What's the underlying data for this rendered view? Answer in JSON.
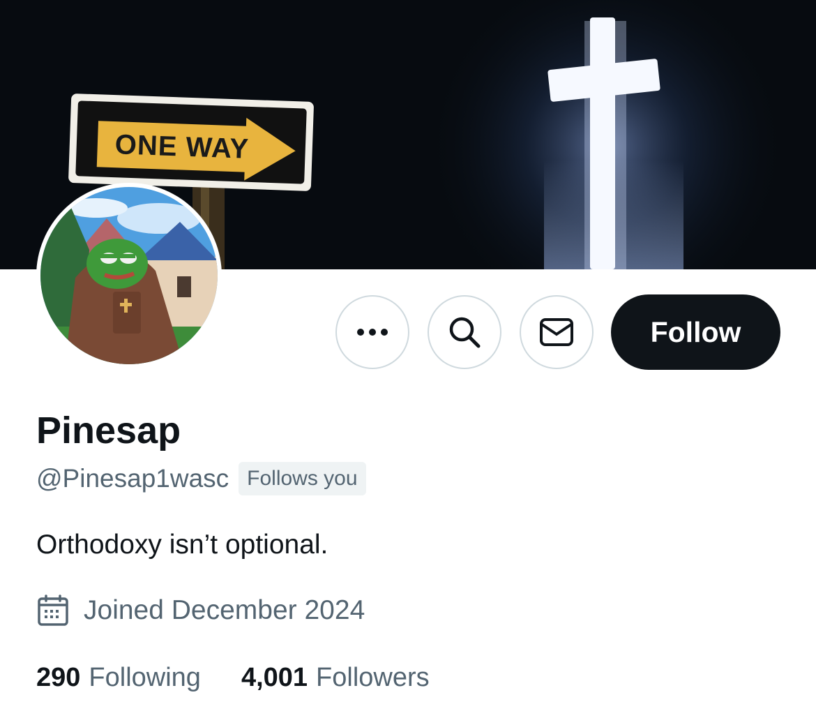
{
  "profile": {
    "display_name": "Pinesap",
    "handle": "@Pinesap1wasc",
    "follows_you_badge": "Follows you",
    "bio": "Orthodoxy isn’t optional.",
    "joined": "Joined December 2024",
    "following_count": "290",
    "following_label": "Following",
    "followers_count": "4,001",
    "followers_label": "Followers"
  },
  "banner": {
    "sign_text": "ONE WAY"
  },
  "actions": {
    "more_icon": "more-horizontal-icon",
    "search_icon": "search-icon",
    "message_icon": "envelope-icon",
    "follow_label": "Follow"
  },
  "colors": {
    "primary_text": "#0f1419",
    "secondary_text": "#536471",
    "button_border": "#cfd9de",
    "badge_bg": "#eff3f4",
    "follow_button_bg": "#0f1419"
  }
}
